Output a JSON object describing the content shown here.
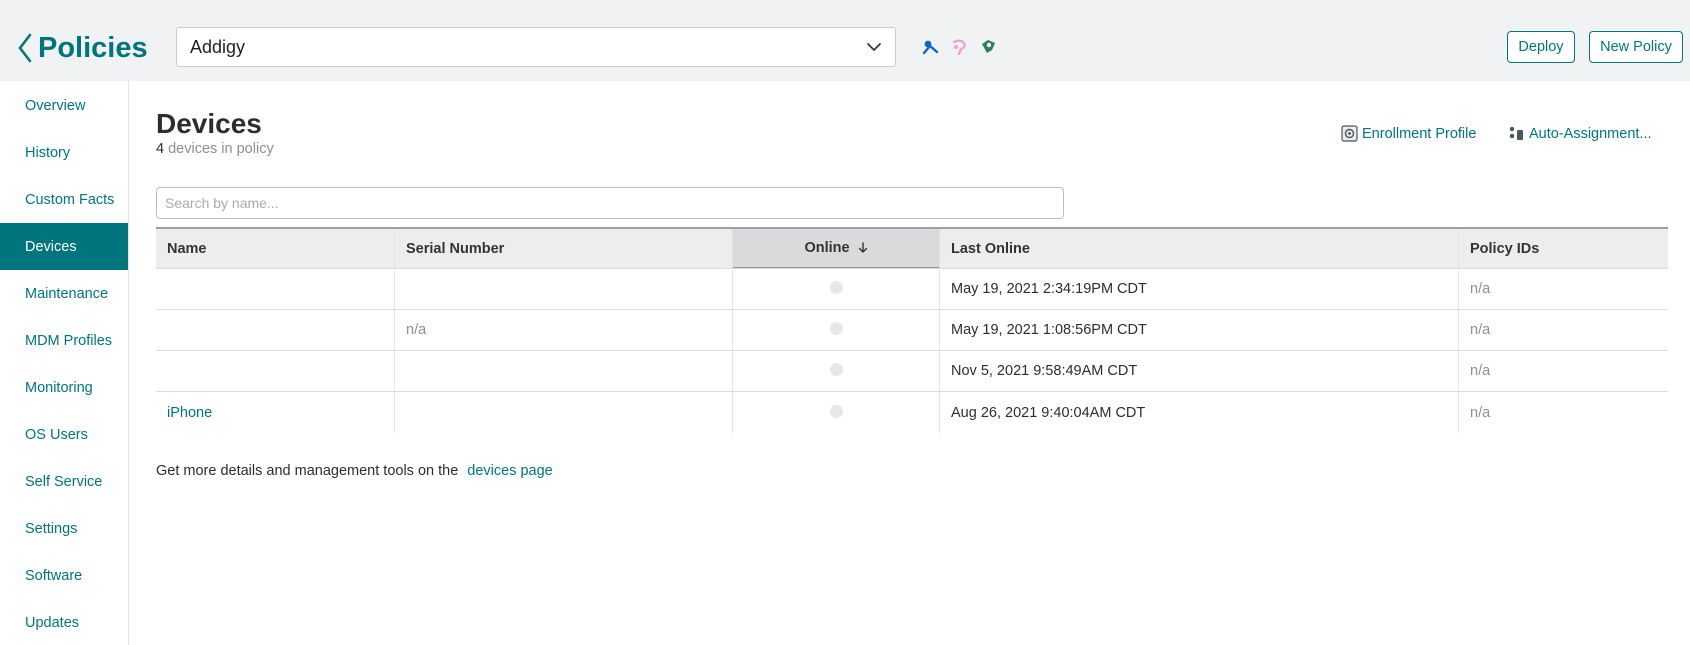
{
  "header": {
    "back_title": "Policies",
    "org_select": {
      "value": "Addigy"
    },
    "status_icons": [
      {
        "icon": "blue-status-icon",
        "color": "#1565c0"
      },
      {
        "icon": "pink-status-icon",
        "color": "#f4a3c4"
      },
      {
        "icon": "green-shield-icon",
        "color": "#2e7d5b"
      }
    ],
    "deploy_label": "Deploy",
    "new_policy_label": "New Policy"
  },
  "sidebar": {
    "items": [
      {
        "label": "Overview"
      },
      {
        "label": "History"
      },
      {
        "label": "Custom Facts"
      },
      {
        "label": "Devices",
        "active": true
      },
      {
        "label": "Maintenance"
      },
      {
        "label": "MDM Profiles"
      },
      {
        "label": "Monitoring"
      },
      {
        "label": "OS Users"
      },
      {
        "label": "Self Service"
      },
      {
        "label": "Settings"
      },
      {
        "label": "Software"
      },
      {
        "label": "Updates"
      }
    ]
  },
  "main": {
    "title": "Devices",
    "count": "4",
    "count_suffix": "devices in policy",
    "enrollment_profile_label": "Enrollment Profile",
    "auto_assignment_label": "Auto-Assignment...",
    "search_placeholder": "Search by name...",
    "table": {
      "columns": [
        "Name",
        "Serial Number",
        "Online",
        "Last Online",
        "Policy IDs"
      ],
      "sorted_column": "Online",
      "rows": [
        {
          "name": "",
          "serial": "",
          "online": false,
          "last_online": "May 19, 2021 2:34:19PM CDT",
          "policy_ids": "n/a"
        },
        {
          "name": "",
          "serial": "n/a",
          "online": false,
          "last_online": "May 19, 2021 1:08:56PM CDT",
          "policy_ids": "n/a"
        },
        {
          "name": "",
          "serial": "",
          "online": false,
          "last_online": "Nov 5, 2021 9:58:49AM CDT",
          "policy_ids": "n/a"
        },
        {
          "name": "iPhone",
          "serial": "",
          "online": false,
          "last_online": "Aug 26, 2021 9:40:04AM CDT",
          "policy_ids": "n/a"
        }
      ]
    },
    "footer_text": "Get more details and management tools on the",
    "footer_link": "devices page"
  },
  "colors": {
    "accent": "#00757e",
    "header_bg": "#f1f2f3",
    "offline_dot": "#e6e7e8"
  }
}
